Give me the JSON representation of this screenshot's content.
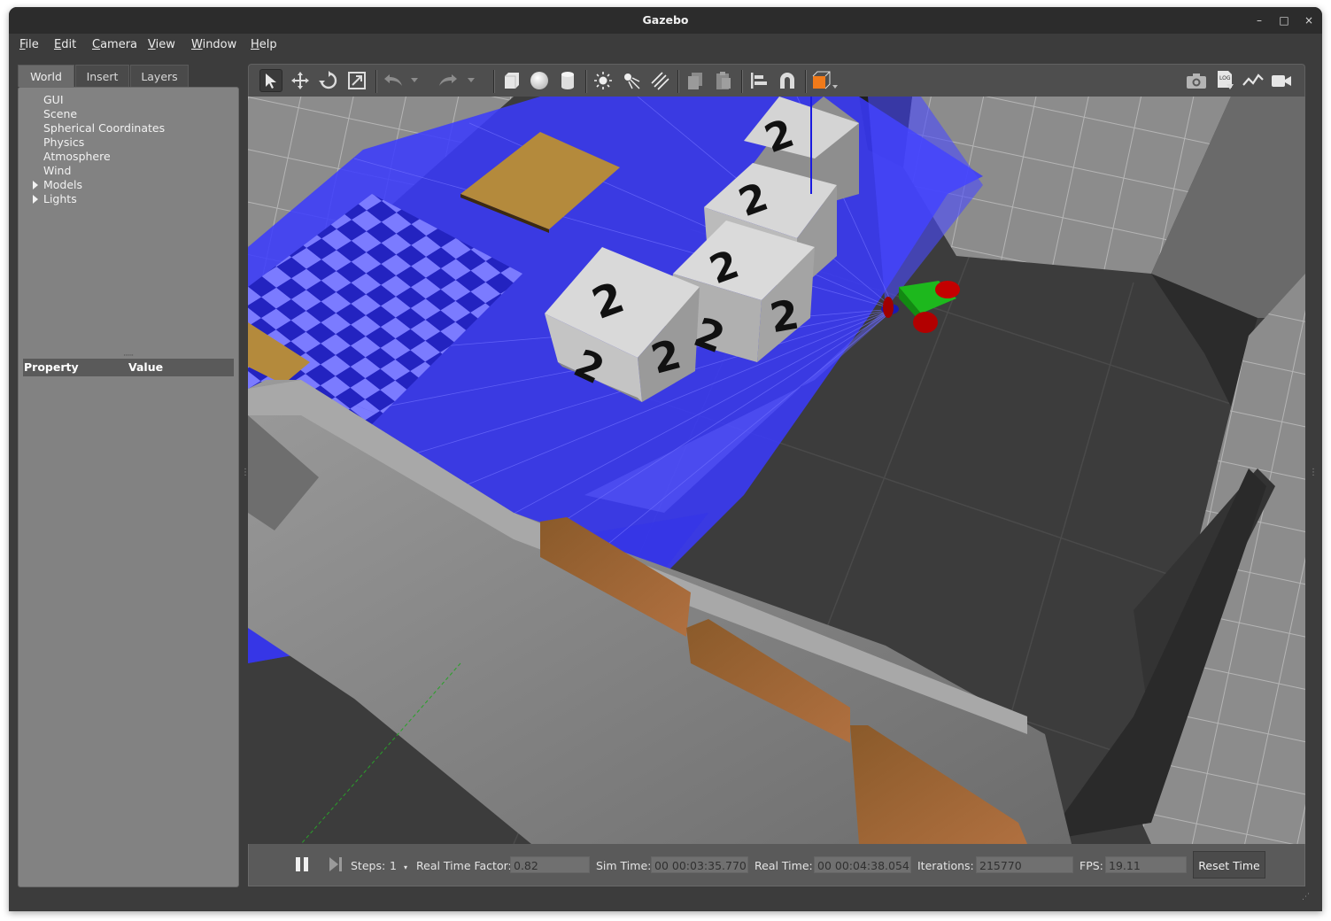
{
  "window": {
    "title": "Gazebo"
  },
  "menu": {
    "items": [
      {
        "label": "File"
      },
      {
        "label": "Edit"
      },
      {
        "label": "Camera"
      },
      {
        "label": "View"
      },
      {
        "label": "Window"
      },
      {
        "label": "Help"
      }
    ]
  },
  "left_panel": {
    "tabs": [
      {
        "label": "World",
        "active": true
      },
      {
        "label": "Insert"
      },
      {
        "label": "Layers"
      }
    ],
    "tree": [
      {
        "label": "GUI"
      },
      {
        "label": "Scene"
      },
      {
        "label": "Spherical Coordinates"
      },
      {
        "label": "Physics"
      },
      {
        "label": "Atmosphere"
      },
      {
        "label": "Wind"
      },
      {
        "label": "Models",
        "expandable": true
      },
      {
        "label": "Lights",
        "expandable": true
      }
    ],
    "properties": {
      "col_property": "Property",
      "col_value": "Value"
    }
  },
  "toolbar": {
    "left_tools": [
      "select-arrow-icon",
      "translate-icon",
      "rotate-icon",
      "scale-icon",
      "undo-icon",
      "undo-dropdown-icon",
      "redo-icon",
      "redo-dropdown-icon",
      "box-icon",
      "sphere-icon",
      "cylinder-icon",
      "point-light-icon",
      "spot-light-icon",
      "directional-light-icon",
      "copy-icon",
      "paste-icon",
      "align-icon",
      "snap-icon",
      "view-angle-icon"
    ],
    "right_tools": [
      "screenshot-icon",
      "log-icon",
      "plot-icon",
      "video-record-icon"
    ]
  },
  "status_bar": {
    "steps_label": "Steps:",
    "steps_value": "1",
    "rtf_label": "Real Time Factor:",
    "rtf_value": "0.82",
    "sim_time_label": "Sim Time:",
    "sim_time_value": "00 00:03:35.770",
    "real_time_label": "Real Time:",
    "real_time_value": "00 00:04:38.054",
    "iterations_label": "Iterations:",
    "iterations_value": "215770",
    "fps_label": "FPS:",
    "fps_value": "19.11",
    "reset_label": "Reset Time"
  },
  "scene": {
    "cube_glyph": "2",
    "colors": {
      "laser": "#3a3aff",
      "robot_body": "#1db81d",
      "robot_wheels": "#c40000",
      "wall": "#8a8a8a",
      "floor": "#3a3a3a"
    }
  }
}
